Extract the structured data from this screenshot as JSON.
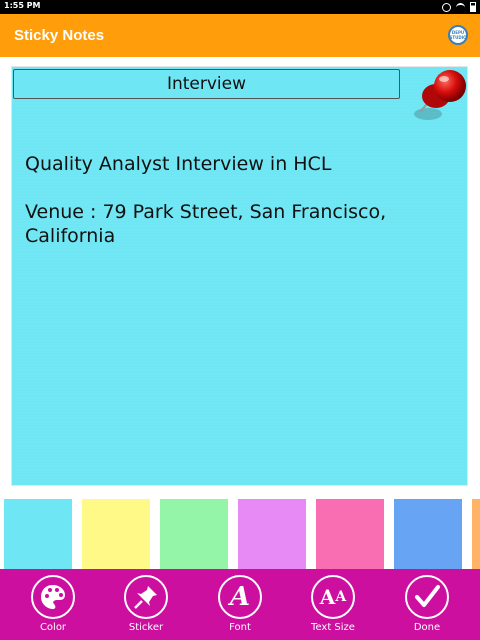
{
  "status_bar": {
    "time": "1:55 PM"
  },
  "app_bar": {
    "title": "Sticky Notes",
    "logo_text": "DEPU STUDIO"
  },
  "note": {
    "title": "Interview",
    "body_line1": "Quality Analyst Interview in HCL",
    "body_line2": "Venue : 79 Park Street, San Francisco, California",
    "background_color": "#6ee6f3"
  },
  "swatches": [
    "#6ee6f3",
    "#fffa88",
    "#94f4a8",
    "#e88af5",
    "#f96eb2",
    "#68a4f4",
    "#ffb366"
  ],
  "toolbar": {
    "color_label": "Color",
    "sticker_label": "Sticker",
    "font_label": "Font",
    "text_size_label": "Text Size",
    "done_label": "Done"
  },
  "colors": {
    "app_bar": "#ff9d0b",
    "bottom_bar": "#cc0f9f"
  }
}
